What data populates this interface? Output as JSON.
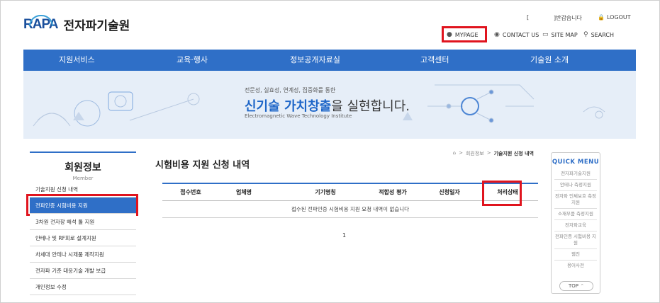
{
  "header": {
    "logo_mark": "RAPA",
    "logo_name": "전자파기술원",
    "user_name": "[",
    "greeting": "]반갑습니다",
    "logout": "LOGOUT",
    "mypage": "MYPAGE",
    "contact": "CONTACT US",
    "sitemap": "SITE MAP",
    "search": "SEARCH"
  },
  "nav": [
    "지원서비스",
    "교육·행사",
    "정보공개자료실",
    "고객센터",
    "기술원 소개"
  ],
  "banner": {
    "line1": "전문성, 실효성, 연계성, 집중화를 통한",
    "line2_pre": "신기술 가치창출",
    "line2_post": "을 실현합니다.",
    "line3": "Electromagnetic Wave Technology Institute"
  },
  "sidebar": {
    "title": "회원정보",
    "subtitle": "Member",
    "items": [
      "기술지원 신청 내역",
      "전파인증 시험비용 지원",
      "3차원 전자장 해석 툴 지원",
      "안테나 및 RF회로 설계지원",
      "차세대 안테나 시제품 제작지원",
      "전자파 기준 대응기술 개발 보급",
      "개인정보 수정"
    ],
    "active_index": 1
  },
  "content": {
    "title": "시험비용 지원 신청 내역",
    "breadcrumb": [
      "회원정보",
      "기술지원 신청 내역"
    ],
    "columns": [
      "접수번호",
      "업체명",
      "기기명칭",
      "적합성 평가",
      "신청일자",
      "처리상태"
    ],
    "empty_message": "접수된 전파인증 시험비용 지원 요청 내역이 없습니다",
    "page": "1"
  },
  "quick_menu": {
    "title": "QUICK MENU",
    "items": [
      "전자파기술지원",
      "안테나 측정지원",
      "전자파 인체보호 측정지원",
      "소재부품 측정지원",
      "전자파교육",
      "전파인증 시험비용 지원",
      "웹진",
      "용어사전"
    ],
    "top": "TOP"
  },
  "colors": {
    "nav_blue": "#2f6fc7",
    "highlight_red": "#e0141e"
  }
}
